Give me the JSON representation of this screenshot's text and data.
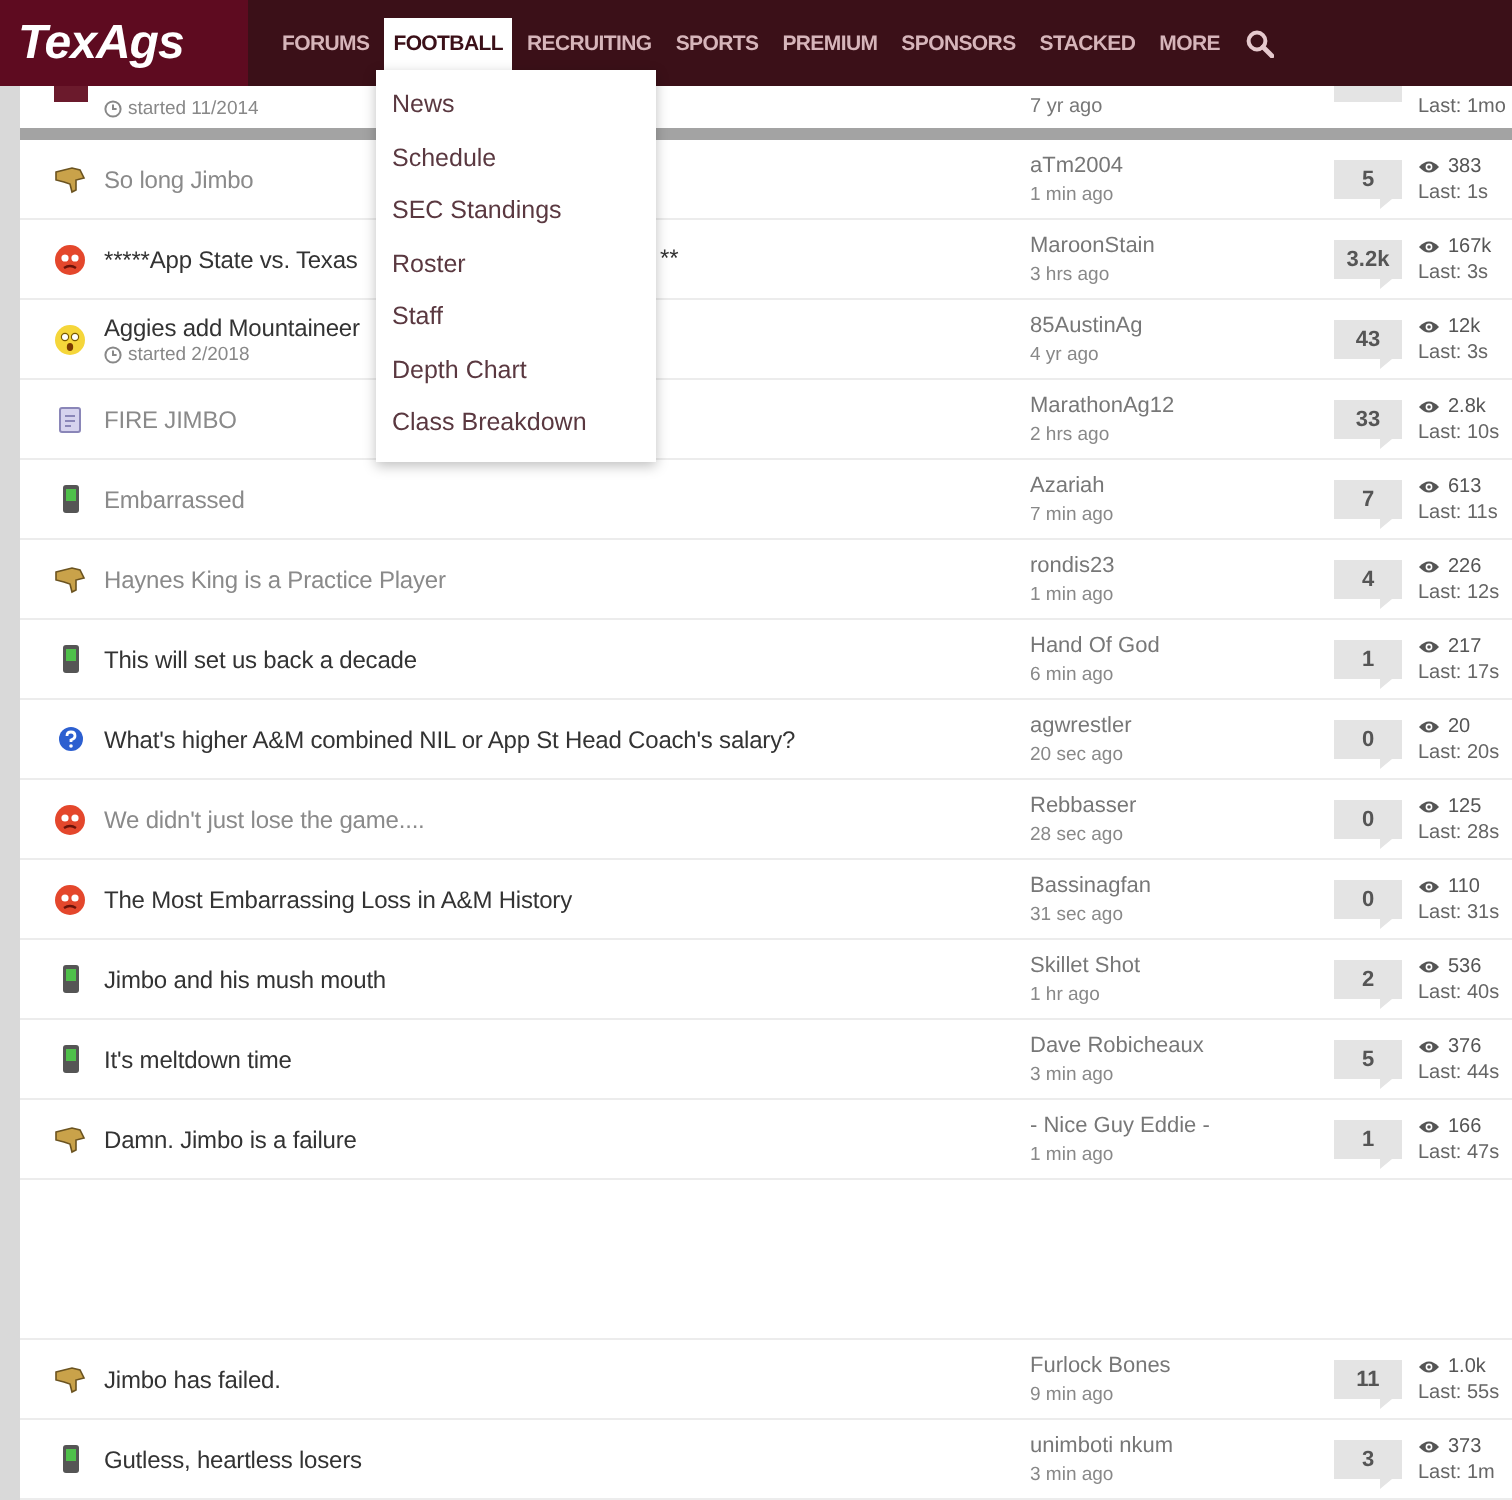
{
  "header": {
    "logo": "TexAgs",
    "nav": [
      {
        "label": "FORUMS",
        "selected": false
      },
      {
        "label": "FOOTBALL",
        "selected": true
      },
      {
        "label": "RECRUITING",
        "selected": false
      },
      {
        "label": "SPORTS",
        "selected": false
      },
      {
        "label": "PREMIUM",
        "selected": false
      },
      {
        "label": "SPONSORS",
        "selected": false
      },
      {
        "label": "STACKED",
        "selected": false
      },
      {
        "label": "MORE",
        "selected": false
      }
    ]
  },
  "dropdown": {
    "items": [
      "News",
      "Schedule",
      "SEC Standings",
      "Roster",
      "Staff",
      "Depth Chart",
      "Class Breakdown"
    ]
  },
  "pinned_row": {
    "started": "started 11/2014",
    "time": "7 yr ago",
    "last": "Last: 1mo"
  },
  "threads": [
    {
      "kind": "thumbs-down",
      "title": "So long Jimbo",
      "visited": true,
      "author": "aTm2004",
      "time": "1 min ago",
      "replies": "5",
      "views": "383",
      "last": "Last: 1s"
    },
    {
      "kind": "angry",
      "title": "*****App State vs. Texas",
      "title_tail": "**",
      "visited": false,
      "author": "MaroonStain",
      "time": "3 hrs ago",
      "replies": "3.2k",
      "views": "167k",
      "last": "Last: 3s"
    },
    {
      "kind": "surprised",
      "title": "Aggies add Mountaineer",
      "started": "started 2/2018",
      "visited": false,
      "author": "85AustinAg",
      "time": "4 yr ago",
      "replies": "43",
      "views": "12k",
      "last": "Last: 3s"
    },
    {
      "kind": "document",
      "title": "FIRE JIMBO",
      "visited": true,
      "author": "MarathonAg12",
      "time": "2 hrs ago",
      "replies": "33",
      "views": "2.8k",
      "last": "Last: 10s"
    },
    {
      "kind": "phone",
      "title": "Embarrassed",
      "visited": true,
      "author": "Azariah",
      "time": "7 min ago",
      "replies": "7",
      "views": "613",
      "last": "Last: 11s"
    },
    {
      "kind": "thumbs-down",
      "title": "Haynes King is a Practice Player",
      "visited": true,
      "author": "rondis23",
      "time": "1 min ago",
      "replies": "4",
      "views": "226",
      "last": "Last: 12s"
    },
    {
      "kind": "phone",
      "title": "This will set us back a decade",
      "visited": false,
      "author": "Hand Of God",
      "time": "6 min ago",
      "replies": "1",
      "views": "217",
      "last": "Last: 17s"
    },
    {
      "kind": "question",
      "title": "What's higher A&M combined NIL or App St Head Coach's salary?",
      "visited": false,
      "author": "agwrestler",
      "time": "20 sec ago",
      "replies": "0",
      "views": "20",
      "last": "Last: 20s"
    },
    {
      "kind": "angry",
      "title": "We didn't just lose the game....",
      "visited": true,
      "author": "Rebbasser",
      "time": "28 sec ago",
      "replies": "0",
      "views": "125",
      "last": "Last: 28s"
    },
    {
      "kind": "angry",
      "title": "The Most Embarrassing Loss in A&M History",
      "visited": false,
      "author": "Bassinagfan",
      "time": "31 sec ago",
      "replies": "0",
      "views": "110",
      "last": "Last: 31s"
    },
    {
      "kind": "phone",
      "title": "Jimbo and his mush mouth",
      "visited": false,
      "author": "Skillet Shot",
      "time": "1 hr ago",
      "replies": "2",
      "views": "536",
      "last": "Last: 40s"
    },
    {
      "kind": "phone",
      "title": "It's meltdown time",
      "visited": false,
      "author": "Dave Robicheaux",
      "time": "3 min ago",
      "replies": "5",
      "views": "376",
      "last": "Last: 44s"
    },
    {
      "kind": "thumbs-down",
      "title": "Damn. Jimbo is a failure",
      "visited": false,
      "author": "- Nice Guy Eddie -",
      "time": "1 min ago",
      "replies": "1",
      "views": "166",
      "last": "Last: 47s"
    },
    {
      "kind": "gap"
    },
    {
      "kind": "thumbs-down",
      "title": "Jimbo has failed.",
      "visited": false,
      "author": "Furlock Bones",
      "time": "9 min ago",
      "replies": "11",
      "views": "1.0k",
      "last": "Last: 55s"
    },
    {
      "kind": "phone",
      "title": "Gutless, heartless losers",
      "visited": false,
      "author": "unimboti nkum",
      "time": "3 min ago",
      "replies": "3",
      "views": "373",
      "last": "Last: 1m"
    }
  ]
}
